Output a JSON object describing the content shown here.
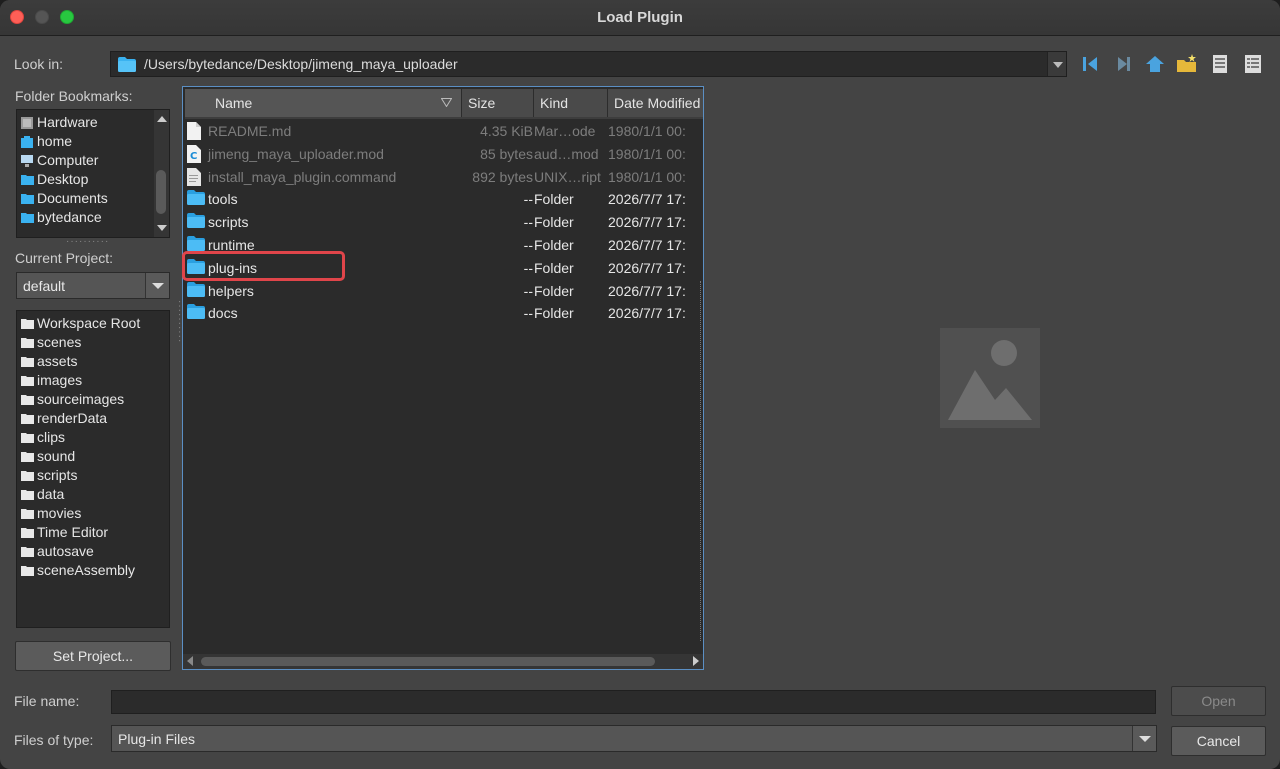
{
  "window": {
    "title": "Load Plugin"
  },
  "look_in": {
    "label": "Look in:",
    "path": "/Users/bytedance/Desktop/jimeng_maya_uploader",
    "toolbar": [
      "back-icon",
      "forward-icon",
      "home-icon",
      "new-folder-icon",
      "list-view-icon",
      "detail-view-icon"
    ]
  },
  "bookmarks": {
    "label": "Folder Bookmarks:",
    "items": [
      {
        "label": "Hardware",
        "icon": "drive-icon"
      },
      {
        "label": "home",
        "icon": "home-folder-icon"
      },
      {
        "label": "Computer",
        "icon": "computer-icon"
      },
      {
        "label": "Desktop",
        "icon": "folder-icon"
      },
      {
        "label": "Documents",
        "icon": "folder-icon"
      },
      {
        "label": "bytedance",
        "icon": "folder-icon"
      }
    ]
  },
  "project": {
    "label": "Current Project:",
    "selected": "default",
    "items": [
      "Workspace Root",
      "scenes",
      "assets",
      "images",
      "sourceimages",
      "renderData",
      "clips",
      "sound",
      "scripts",
      "data",
      "movies",
      "Time Editor",
      "autosave",
      "sceneAssembly"
    ],
    "set_button": "Set Project..."
  },
  "files": {
    "columns": [
      "Name",
      "Size",
      "Kind",
      "Date Modified"
    ],
    "rows": [
      {
        "name": "README.md",
        "size": "4.35 KiB",
        "kind": "Mar…ode",
        "date": "1980/1/1 00:",
        "type": "file",
        "dim": true
      },
      {
        "name": "jimeng_maya_uploader.mod",
        "size": "85 bytes",
        "kind": "aud…mod",
        "date": "1980/1/1 00:",
        "type": "mod",
        "dim": true
      },
      {
        "name": "install_maya_plugin.command",
        "size": "892 bytes",
        "kind": "UNIX…ript",
        "date": "1980/1/1 00:",
        "type": "script",
        "dim": true
      },
      {
        "name": "tools",
        "size": "--",
        "kind": "Folder",
        "date": "2026/7/7 17:",
        "type": "folder",
        "dim": false
      },
      {
        "name": "scripts",
        "size": "--",
        "kind": "Folder",
        "date": "2026/7/7 17:",
        "type": "folder",
        "dim": false
      },
      {
        "name": "runtime",
        "size": "--",
        "kind": "Folder",
        "date": "2026/7/7 17:",
        "type": "folder",
        "dim": false
      },
      {
        "name": "plug-ins",
        "size": "--",
        "kind": "Folder",
        "date": "2026/7/7 17:",
        "type": "folder",
        "dim": false
      },
      {
        "name": "helpers",
        "size": "--",
        "kind": "Folder",
        "date": "2026/7/7 17:",
        "type": "folder",
        "dim": false
      },
      {
        "name": "docs",
        "size": "--",
        "kind": "Folder",
        "date": "2026/7/7 17:",
        "type": "folder",
        "dim": false
      }
    ]
  },
  "file_name": {
    "label": "File name:",
    "value": ""
  },
  "file_type": {
    "label": "Files of type:",
    "value": "Plug-in Files"
  },
  "buttons": {
    "open": "Open",
    "cancel": "Cancel"
  },
  "colors": {
    "folder": "#3ab2f0",
    "highlight": "#e0454a",
    "accent": "#5b8fc4"
  }
}
